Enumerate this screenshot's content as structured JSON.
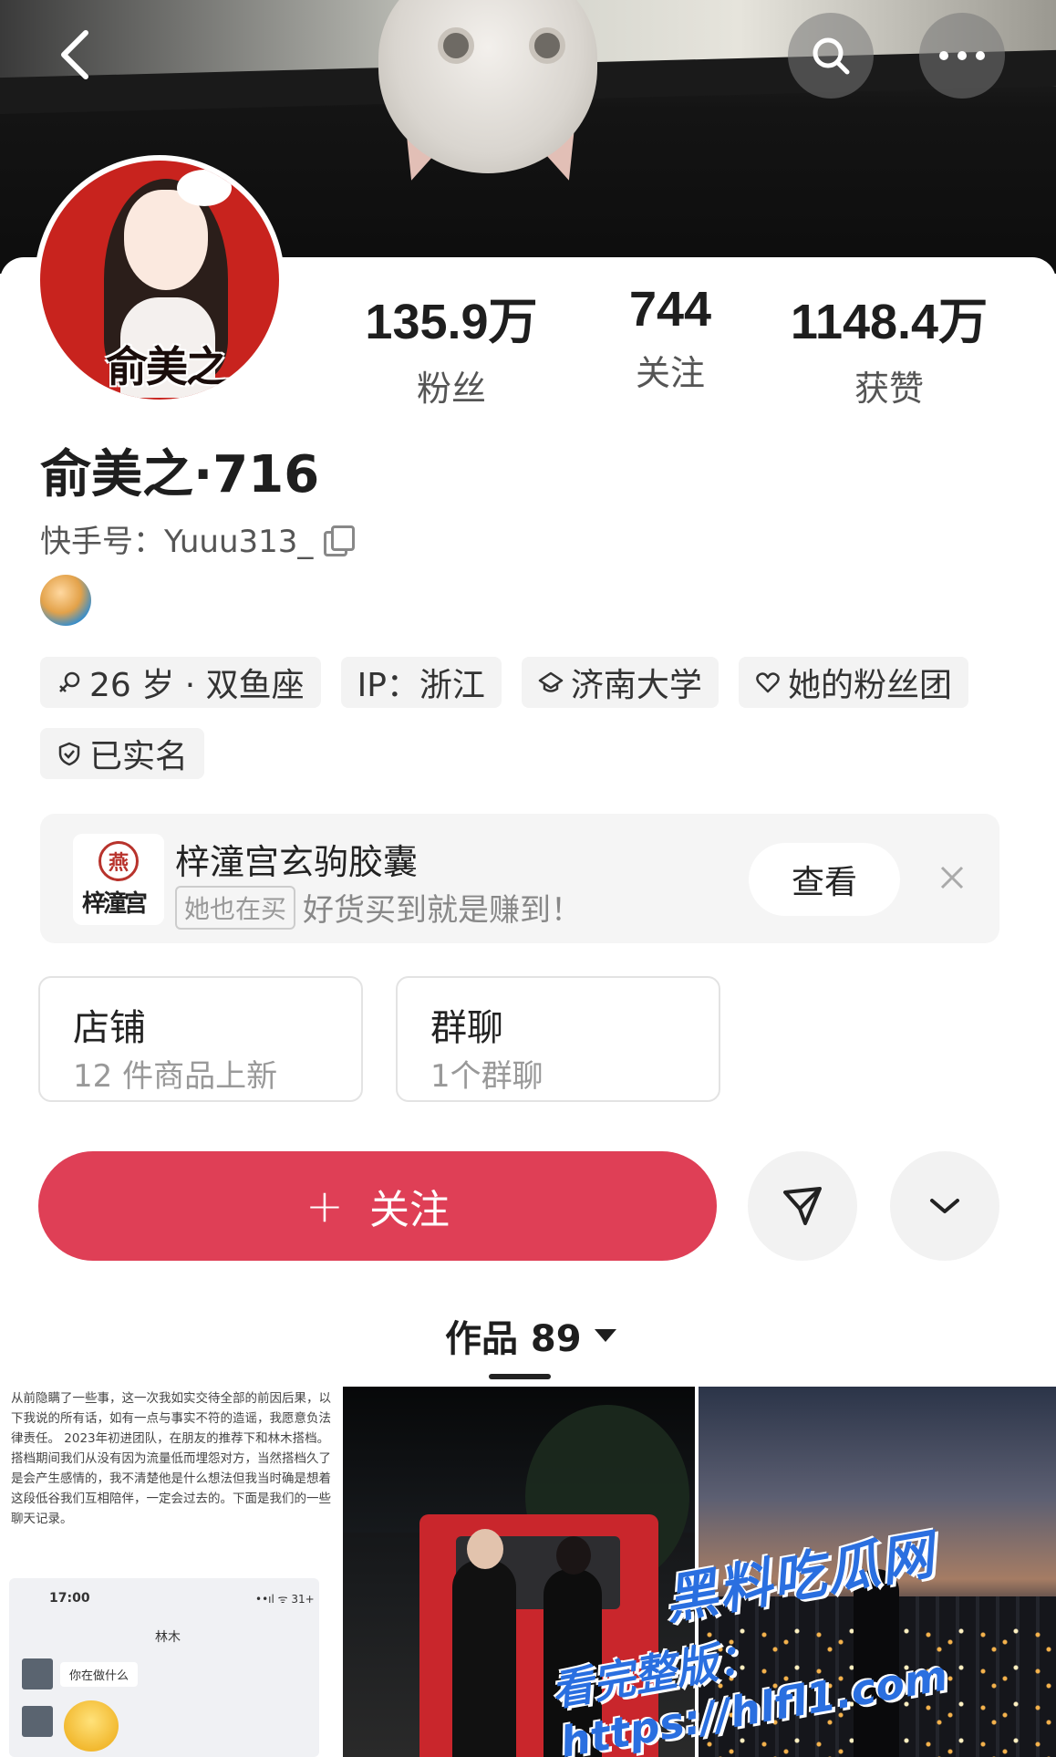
{
  "header": {
    "back_icon": "chevron-left-icon",
    "search_icon": "search-icon",
    "more_icon": "more-horizontal-icon"
  },
  "profile": {
    "avatar_text": "俞美之",
    "username": "俞美之·716",
    "kuaishou_id": "快手号：Yuuu313_",
    "stats": {
      "fans": {
        "value": "135.9万",
        "label": "粉丝"
      },
      "following": {
        "value": "744",
        "label": "关注"
      },
      "likes": {
        "value": "1148.4万",
        "label": "获赞"
      }
    },
    "tags": [
      {
        "icon": "gender-icon",
        "label": "26 岁 · 双鱼座"
      },
      {
        "icon": "",
        "label": "IP：浙江"
      },
      {
        "icon": "graduation-cap-icon",
        "label": "济南大学"
      },
      {
        "icon": "heart-icon",
        "label": "她的粉丝团"
      },
      {
        "icon": "shield-check-icon",
        "label": "已实名"
      }
    ]
  },
  "promo": {
    "shop_logo_text": "梓潼宫",
    "seal_char": "燕",
    "title": "梓潼宫玄驹胶囊",
    "badge": "她也在买",
    "slogan": "好货买到就是赚到！",
    "view_label": "查看"
  },
  "boxes": {
    "shop": {
      "title": "店铺",
      "subtitle": "12 件商品上新"
    },
    "group": {
      "title": "群聊",
      "subtitle": "1个群聊"
    }
  },
  "actions": {
    "follow_label": "关注",
    "follow_plus": "+"
  },
  "works": {
    "tab_label": "作品 89"
  },
  "thumbs": {
    "t1": {
      "paragraph": "从前隐瞒了一些事，这一次我如实交待全部的前因后果，以下我说的所有话，如有一点与事实不符的造谣，我愿意负法律责任。 2023年初进团队，在朋友的推荐下和林木搭档。搭档期间我们从没有因为流量低而埋怨对方，当然搭档久了是会产生感情的，我不清楚他是什么想法但我当时确是想着这段低谷我们互相陪伴，一定会过去的。下面是我们的一些聊天记录。",
      "time": "17:00",
      "status": "••ıl ᯤ 31+",
      "chat_name": "林木",
      "bubble": "你在做什么"
    }
  },
  "watermark": {
    "line1": "黑料吃瓜网",
    "line2": "看完整版：https://hlfl1.com"
  },
  "colors": {
    "follow_button": "#df3f56",
    "avatar_bg": "#c8231e",
    "watermark": "#2a6fe0"
  }
}
